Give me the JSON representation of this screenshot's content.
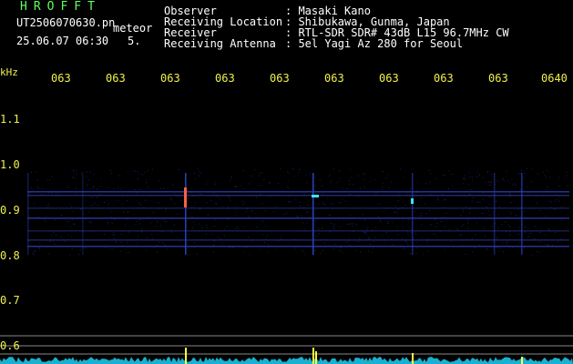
{
  "header": {
    "logo": "HROFFT",
    "filename": "UT2506070630.pn",
    "event_type": "meteor",
    "datetime": "25.06.07 06:30",
    "count": "5.",
    "fields": [
      {
        "label": "Observer",
        "value": ": Masaki Kano"
      },
      {
        "label": "Receiving Location",
        "value": ": Shibukawa, Gunma, Japan"
      },
      {
        "label": "Receiver",
        "value": ": RTL-SDR SDR# 43dB L15 96.7MHz CW"
      },
      {
        "label": "Receiving Antenna",
        "value": ": 5el Yagi Az 280 for Seoul"
      }
    ]
  },
  "axis": {
    "y_unit": "kHz",
    "y_ticks": [
      "1.1",
      "1.0",
      "0.9",
      "0.8",
      "0.7",
      "0.6"
    ],
    "x_ticks": [
      "063",
      "063",
      "063",
      "063",
      "063",
      "063",
      "063",
      "063",
      "063",
      "0640"
    ]
  },
  "colors": {
    "background": "#000000",
    "text_yellow": "#f0f050",
    "text_green": "#5fff5f",
    "signal_blue": "#2a3aa0",
    "bright_cyan": "#40e0ff",
    "meteor_yellow": "#ffff40"
  }
}
